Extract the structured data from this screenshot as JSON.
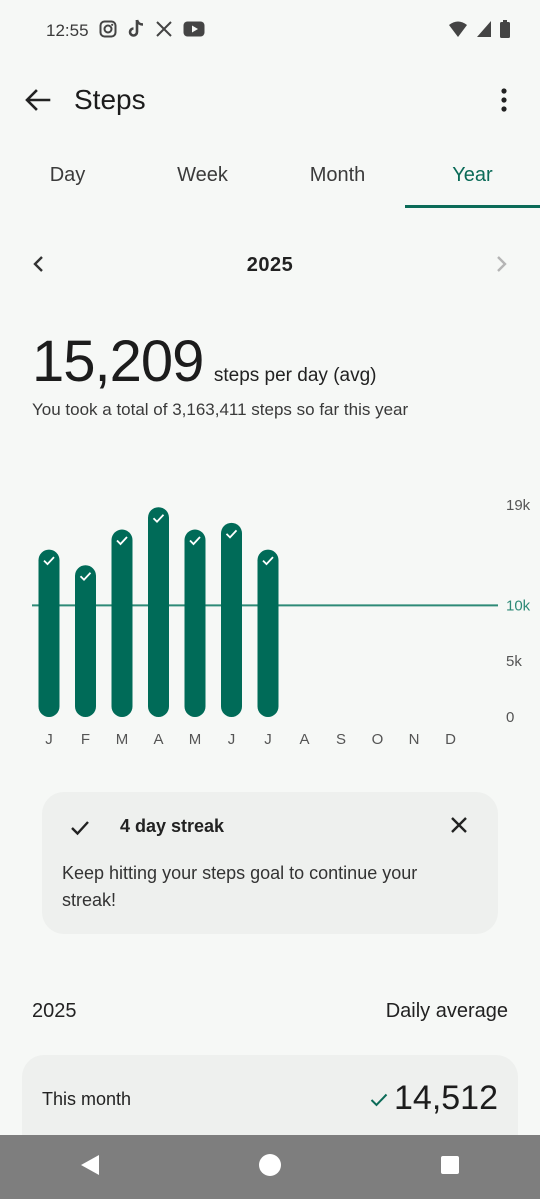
{
  "status_bar": {
    "time": "12:55",
    "left_icons": [
      "instagram-icon",
      "tiktok-icon",
      "x-icon",
      "youtube-icon"
    ],
    "right_icons": [
      "wifi-icon",
      "signal-icon",
      "battery-icon"
    ]
  },
  "app_bar": {
    "title": "Steps"
  },
  "tabs": [
    {
      "label": "Day"
    },
    {
      "label": "Week"
    },
    {
      "label": "Month"
    },
    {
      "label": "Year",
      "active": true
    }
  ],
  "period": {
    "label": "2025"
  },
  "summary": {
    "value": "15,209",
    "unit": "steps per day (avg)",
    "total_text": "You took a total of 3,163,411 steps so far this year"
  },
  "chart_data": {
    "type": "bar",
    "categories": [
      "J",
      "F",
      "M",
      "A",
      "M",
      "J",
      "J",
      "A",
      "S",
      "O",
      "N",
      "D"
    ],
    "values": [
      15000,
      13600,
      16800,
      18800,
      16800,
      17400,
      15000,
      null,
      null,
      null,
      null,
      null
    ],
    "goal_met": [
      true,
      true,
      true,
      true,
      true,
      true,
      true,
      false,
      false,
      false,
      false,
      false
    ],
    "goal_line": 10000,
    "y_ticks": [
      {
        "value": 0,
        "label": "0"
      },
      {
        "value": 5000,
        "label": "5k"
      },
      {
        "value": 10000,
        "label": "10k"
      },
      {
        "value": 19000,
        "label": "19k"
      }
    ],
    "ylim": [
      0,
      19000
    ],
    "bar_color": "#006b58",
    "goal_line_color": "#2e8a77"
  },
  "streak": {
    "title": "4 day streak",
    "body": "Keep hitting your steps goal to continue your streak!"
  },
  "list": {
    "year": "2025",
    "column": "Daily average",
    "rows": [
      {
        "label": "This month",
        "value": "14,512",
        "goal_met": true
      }
    ]
  },
  "colors": {
    "accent": "#0b6b58",
    "background": "#f6f8f6",
    "card": "#eef0ee",
    "nav_bar": "#7e7e7e"
  }
}
